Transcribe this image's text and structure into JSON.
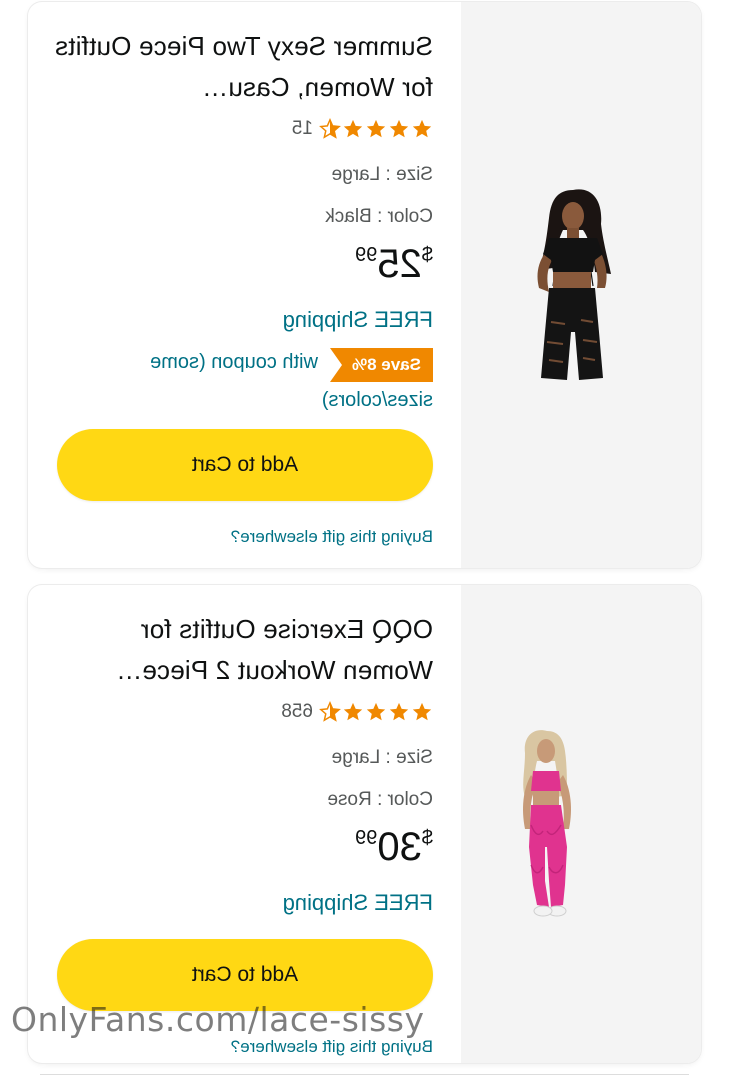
{
  "products": [
    {
      "title": "Summer Sexy Two Piece Outfits for Women, Casu…",
      "rating": 4.5,
      "rating_count": "15",
      "size_label": "Size : Large",
      "color_label": "Color : Black",
      "price_currency": "$",
      "price_whole": "25",
      "price_fraction": "99",
      "shipping": "FREE Shipping",
      "coupon_badge": "Save 8%",
      "coupon_text": "with coupon (some",
      "coupon_text_cont": "sizes/colors)",
      "add_to_cart": "Add to Cart",
      "gift_link": "Buying this gift elsewhere?",
      "image_icon": "black-two-piece-outfit-photo"
    },
    {
      "title": "OQQ Exercise Outfits for Women Workout 2 Piece…",
      "rating": 4.5,
      "rating_count": "658",
      "size_label": "Size : Large",
      "color_label": "Color : Rose",
      "price_currency": "$",
      "price_whole": "30",
      "price_fraction": "99",
      "shipping": "FREE Shipping",
      "add_to_cart": "Add to Cart",
      "gift_link": "Buying this gift elsewhere?",
      "image_icon": "pink-workout-outfit-photo"
    }
  ],
  "watermark": "OnlyFans.com/lace-sissy",
  "colors": {
    "star": "#f08800",
    "link": "#007185",
    "button": "#ffd814",
    "coupon": "#f08800"
  }
}
